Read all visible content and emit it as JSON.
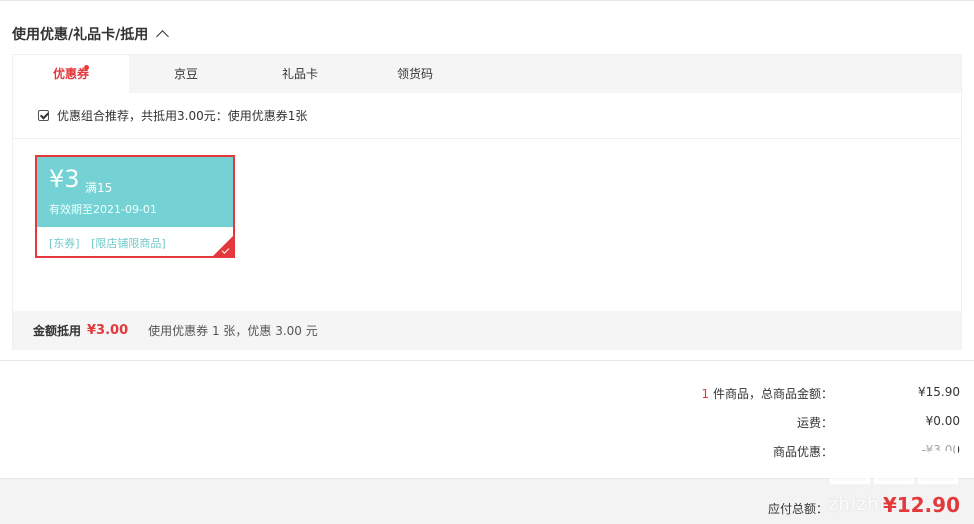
{
  "section": {
    "title": "使用优惠/礼品卡/抵用"
  },
  "tabs": [
    {
      "label": "优惠券",
      "active": true,
      "has_dot": true
    },
    {
      "label": "京豆"
    },
    {
      "label": "礼品卡"
    },
    {
      "label": "领货码"
    }
  ],
  "combo": {
    "checked": true,
    "text": "优惠组合推荐，共抵用3.00元：使用优惠券1张"
  },
  "coupon": {
    "amount": "¥3",
    "threshold": "满15",
    "expiry": "有效期至2021-09-01",
    "tags": [
      "[东券]",
      "[限店铺限商品]"
    ],
    "selected": true
  },
  "summary": {
    "label": "金额抵用",
    "amount": "¥3.00",
    "desc": "使用优惠券 1 张，优惠 3.00 元"
  },
  "totals": {
    "item_count": "1",
    "goods_label": " 件商品，总商品金额：",
    "goods_value": "¥15.90",
    "shipping_label": "运费：",
    "shipping_value": "¥0.00",
    "discount_label": "商品优惠：",
    "discount_value": "-¥3.00"
  },
  "footer": {
    "label": "应付总额：",
    "amount": "¥12.90"
  },
  "watermark": {
    "text": "zhizhi"
  },
  "colors": {
    "accent": "#e4393c",
    "coupon_teal": "#74d2d4"
  },
  "icons": {
    "collapse": "chevron-up-icon",
    "selected": "check-icon"
  }
}
